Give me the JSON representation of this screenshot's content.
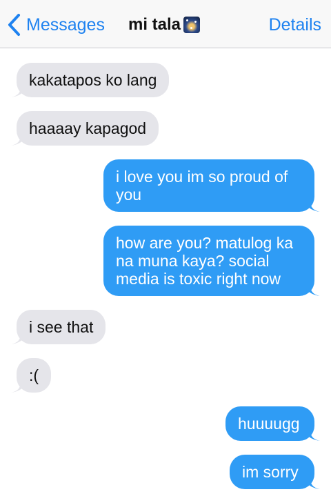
{
  "header": {
    "back_label": "Messages",
    "title": "mi tala",
    "title_icon": "night-sky-emoji-icon",
    "details_label": "Details"
  },
  "colors": {
    "accent": "#1e82f0",
    "incoming_bubble": "#e5e5ea",
    "outgoing_bubble": "#2f9cf5"
  },
  "messages": [
    {
      "direction": "incoming",
      "text": "kakatapos ko lang"
    },
    {
      "direction": "incoming",
      "text": "haaaay kapagod"
    },
    {
      "direction": "outgoing",
      "text": "i love you im so proud of you"
    },
    {
      "direction": "outgoing",
      "text": "how are you? matulog ka na muna kaya? social media is toxic right now"
    },
    {
      "direction": "incoming",
      "text": "i see that"
    },
    {
      "direction": "incoming",
      "text": ":("
    },
    {
      "direction": "outgoing",
      "text": "huuuugg"
    },
    {
      "direction": "outgoing",
      "text": "im sorry"
    }
  ]
}
